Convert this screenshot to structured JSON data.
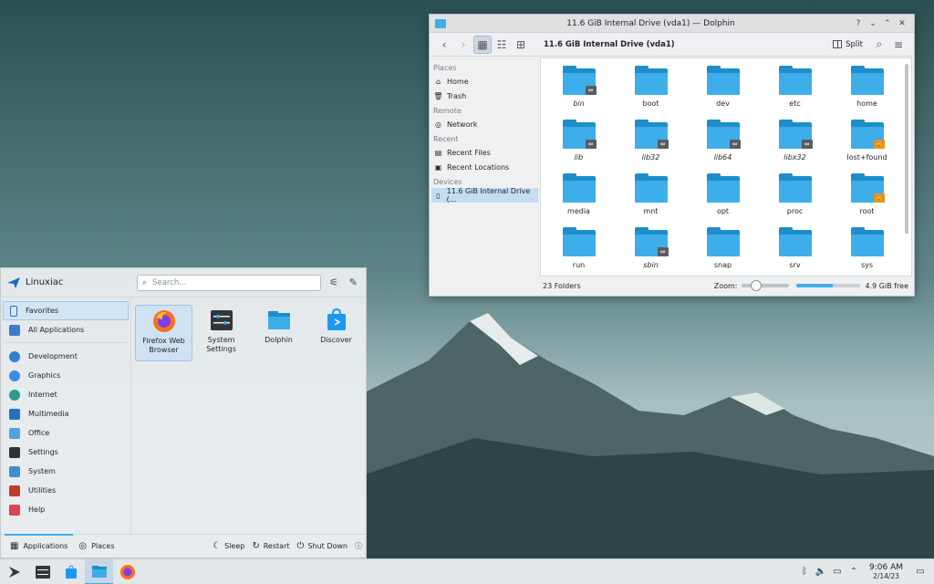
{
  "dolphin": {
    "title": "11.6 GiB Internal Drive (vda1) — Dolphin",
    "window_buttons": [
      "?",
      "⌄",
      "⌃",
      "✕"
    ],
    "location": "11.6 GiB Internal Drive (vda1)",
    "split_label": "Split",
    "places": {
      "sections": [
        {
          "header": "Places",
          "items": [
            {
              "label": "Home",
              "icon": "home-icon"
            },
            {
              "label": "Trash",
              "icon": "trash-icon"
            }
          ]
        },
        {
          "header": "Remote",
          "items": [
            {
              "label": "Network",
              "icon": "network-icon"
            }
          ]
        },
        {
          "header": "Recent",
          "items": [
            {
              "label": "Recent Files",
              "icon": "recent-files-icon"
            },
            {
              "label": "Recent Locations",
              "icon": "recent-locations-icon"
            }
          ]
        },
        {
          "header": "Devices",
          "items": [
            {
              "label": "11.6 GiB Internal Drive (...",
              "icon": "drive-icon",
              "selected": true
            }
          ]
        }
      ]
    },
    "folders": [
      {
        "name": "bin",
        "italic": true,
        "emblem": "link"
      },
      {
        "name": "boot",
        "italic": false,
        "emblem": ""
      },
      {
        "name": "dev",
        "italic": false,
        "emblem": ""
      },
      {
        "name": "etc",
        "italic": false,
        "emblem": ""
      },
      {
        "name": "home",
        "italic": false,
        "emblem": ""
      },
      {
        "name": "lib",
        "italic": true,
        "emblem": "link"
      },
      {
        "name": "lib32",
        "italic": true,
        "emblem": "link"
      },
      {
        "name": "lib64",
        "italic": true,
        "emblem": "link"
      },
      {
        "name": "libx32",
        "italic": true,
        "emblem": "link"
      },
      {
        "name": "lost+found",
        "italic": false,
        "emblem": "lock"
      },
      {
        "name": "media",
        "italic": false,
        "emblem": ""
      },
      {
        "name": "mnt",
        "italic": false,
        "emblem": ""
      },
      {
        "name": "opt",
        "italic": false,
        "emblem": ""
      },
      {
        "name": "proc",
        "italic": false,
        "emblem": ""
      },
      {
        "name": "root",
        "italic": false,
        "emblem": "lock"
      },
      {
        "name": "run",
        "italic": false,
        "emblem": ""
      },
      {
        "name": "sbin",
        "italic": true,
        "emblem": "link"
      },
      {
        "name": "snap",
        "italic": false,
        "emblem": ""
      },
      {
        "name": "srv",
        "italic": false,
        "emblem": ""
      },
      {
        "name": "sys",
        "italic": false,
        "emblem": ""
      }
    ],
    "status": {
      "count": "23 Folders",
      "zoom_label": "Zoom:",
      "zoom_level": 0.2,
      "free_space": "4.9 GiB free",
      "used_fraction": 0.58
    },
    "colors": {
      "folder": "#3daee9",
      "accent": "#3daee9"
    }
  },
  "launcher": {
    "user": "Linuxiac",
    "search_placeholder": "Search...",
    "categories": [
      {
        "label": "Favorites",
        "icon": "favorites-icon",
        "color": "#3b6fb6",
        "selected": true
      },
      {
        "label": "All Applications",
        "icon": "all-applications-icon",
        "color": "#3d7cc9",
        "separator_after": true
      },
      {
        "label": "Development",
        "icon": "development-icon",
        "color": "#2f7fd2"
      },
      {
        "label": "Graphics",
        "icon": "graphics-icon",
        "color": "#3a8ee0"
      },
      {
        "label": "Internet",
        "icon": "internet-icon",
        "color": "#2a9d8f"
      },
      {
        "label": "Multimedia",
        "icon": "multimedia-icon",
        "color": "#2471c4"
      },
      {
        "label": "Office",
        "icon": "office-icon",
        "color": "#4aa4e0"
      },
      {
        "label": "Settings",
        "icon": "settings-icon",
        "color": "#2f3338"
      },
      {
        "label": "System",
        "icon": "system-icon",
        "color": "#3c8fcf"
      },
      {
        "label": "Utilities",
        "icon": "utilities-icon",
        "color": "#c0392b"
      },
      {
        "label": "Help",
        "icon": "help-icon",
        "color": "#da4453"
      }
    ],
    "apps": [
      {
        "label": "Firefox Web Browser",
        "icon": "firefox-icon",
        "selected": true
      },
      {
        "label": "System Settings",
        "icon": "system-settings-icon"
      },
      {
        "label": "Dolphin",
        "icon": "dolphin-icon"
      },
      {
        "label": "Discover",
        "icon": "discover-icon"
      }
    ],
    "footer": {
      "tabs": [
        {
          "label": "Applications",
          "icon": "grid-icon",
          "active": true
        },
        {
          "label": "Places",
          "icon": "compass-icon"
        }
      ],
      "actions": [
        {
          "label": "Sleep",
          "icon": "sleep-icon"
        },
        {
          "label": "Restart",
          "icon": "restart-icon"
        },
        {
          "label": "Shut Down",
          "icon": "power-icon"
        }
      ]
    }
  },
  "taskbar": {
    "tasks": [
      {
        "icon": "kde-launcher-icon",
        "active": false
      },
      {
        "icon": "system-settings-task-icon",
        "active": false
      },
      {
        "icon": "discover-task-icon",
        "active": false
      },
      {
        "icon": "dolphin-task-icon",
        "active": true
      },
      {
        "icon": "firefox-task-icon",
        "active": false
      }
    ],
    "tray_icons": [
      "bluetooth-icon",
      "volume-icon",
      "network-tray-icon",
      "chevron-up-icon"
    ],
    "time": "9:06 AM",
    "date": "2/14/23"
  }
}
